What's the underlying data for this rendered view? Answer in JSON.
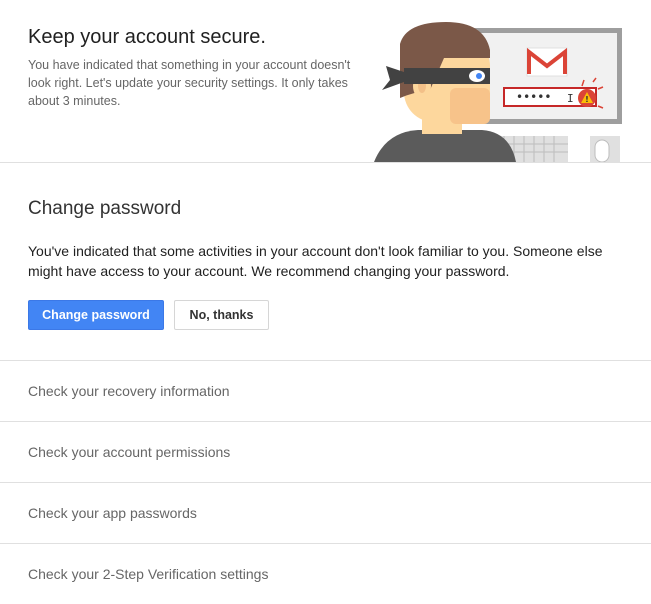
{
  "header": {
    "title": "Keep your account secure.",
    "description": "You have indicated that something in your account doesn't look right. Let's update your security settings. It only takes about 3 minutes.",
    "password_dots": "•••••",
    "cursor_glyph": "I",
    "warning_glyph": "!"
  },
  "change_password": {
    "title": "Change password",
    "description": "You've indicated that some activities in your account don't look familiar to you. Someone else might have access to your account. We recommend changing your password.",
    "primary_button": "Change password",
    "secondary_button": "No, thanks"
  },
  "checks": [
    {
      "label": "Check your recovery information"
    },
    {
      "label": "Check your account permissions"
    },
    {
      "label": "Check your app passwords"
    },
    {
      "label": "Check your 2-Step Verification settings"
    }
  ],
  "colors": {
    "accent": "#4285f4",
    "warning": "#db4437"
  }
}
